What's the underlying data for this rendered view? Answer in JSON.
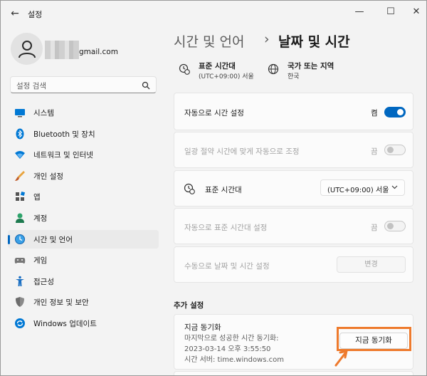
{
  "window": {
    "title": "설정"
  },
  "account": {
    "email": "gmail.com"
  },
  "search": {
    "placeholder": "설정 검색"
  },
  "sidebar": {
    "items": [
      {
        "label": "시스템",
        "icon": "monitor-icon"
      },
      {
        "label": "Bluetooth 및 장치",
        "icon": "bluetooth-icon"
      },
      {
        "label": "네트워크 및 인터넷",
        "icon": "wifi-icon"
      },
      {
        "label": "개인 설정",
        "icon": "brush-icon"
      },
      {
        "label": "앱",
        "icon": "apps-icon"
      },
      {
        "label": "계정",
        "icon": "person-icon"
      },
      {
        "label": "시간 및 언어",
        "icon": "clock-globe-icon",
        "active": true
      },
      {
        "label": "게임",
        "icon": "gamepad-icon"
      },
      {
        "label": "접근성",
        "icon": "accessibility-icon"
      },
      {
        "label": "개인 정보 및 보안",
        "icon": "shield-icon"
      },
      {
        "label": "Windows 업데이트",
        "icon": "update-icon"
      }
    ]
  },
  "breadcrumb": {
    "parent": "시간 및 언어",
    "separator": "›",
    "current": "날짜 및 시간"
  },
  "summary": {
    "timezone_title": "표준 시간대",
    "timezone_value": "(UTC+09:00) 서울",
    "region_title": "국가 또는 지역",
    "region_value": "한국"
  },
  "settings": {
    "auto_time": {
      "label": "자동으로 시간 설정",
      "state": "켬",
      "on": true
    },
    "dst": {
      "label": "일광 절약 시간에 맞게 자동으로 조정",
      "state": "끔",
      "on": false
    },
    "timezone": {
      "label": "표준 시간대",
      "value": "(UTC+09:00) 서울"
    },
    "auto_timezone": {
      "label": "자동으로 표준 시간대 설정",
      "state": "끔",
      "on": false
    },
    "manual": {
      "label": "수동으로 날짜 및 시간 설정",
      "button": "변경"
    }
  },
  "additional": {
    "title": "추가 설정",
    "sync_title": "지금 동기화",
    "sync_last": "마지막으로 성공한 시간 동기화:",
    "sync_time": "2023-03-14 오후 3:55:50",
    "sync_server": "시간 서버: time.windows.com",
    "sync_button": "지금 동기화"
  },
  "colors": {
    "accent": "#0067c0",
    "highlight": "#ee7a2c"
  }
}
